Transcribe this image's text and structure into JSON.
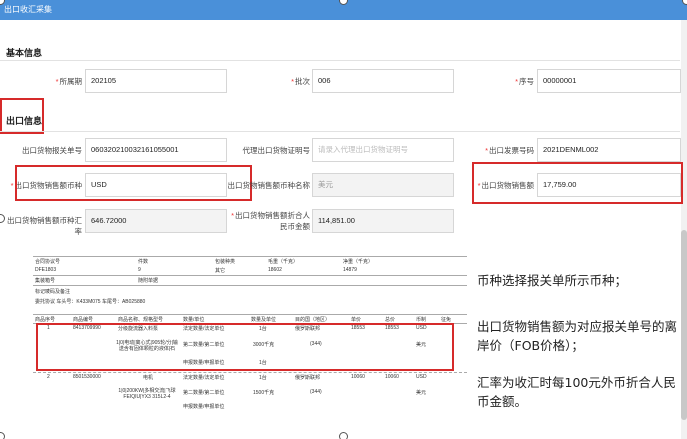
{
  "window": {
    "title": "出口收汇采集"
  },
  "basic": {
    "section_title": "基本信息",
    "period_label": "所属期",
    "period_value": "202105",
    "batch_label": "批次",
    "batch_value": "006",
    "seq_label": "序号",
    "seq_value": "00000001"
  },
  "export": {
    "section_title": "出口信息",
    "customs_label": "出口货物报关单号",
    "customs_value": "060320210032161055001",
    "agent_label": "代理出口货物证明号",
    "agent_placeholder": "请录入代理出口货物证明号",
    "invoice_label": "出口发票号码",
    "invoice_value": "2021DENML002",
    "currency_label": "出口货物销售额币种",
    "currency_value": "USD",
    "currency_name_label": "出口货物销售额币种名称",
    "currency_name_value": "美元",
    "sales_label": "出口货物销售额",
    "sales_value": "17,759.00",
    "rate_label": "出口货物销售额币种汇率",
    "rate_value": "646.72000",
    "rmb_label": "出口货物销售额折合人民币金额",
    "rmb_value": "114,851.00"
  },
  "document": {
    "header_row1": [
      "合同协议号",
      "件数",
      "包装种类",
      "毛重（千克）",
      "净重（千克）"
    ],
    "header_row1_values": [
      "DFE1803",
      "9",
      "其它",
      "18602",
      "14879"
    ],
    "mark_label": "集装箱号",
    "mark_value": "随附单据",
    "remark_label": "标记唛码及备注",
    "remark_value": "委托协议 车头号：K433M075 车尾号：AB025880",
    "cols": [
      "项号",
      "商品编号",
      "商品名称、规格型号",
      "数量及单位",
      "单价/总价/币制",
      "原产国(地区)",
      "最终目的国(地区)",
      "境内货源地",
      "征免"
    ],
    "col_short": [
      "商品序号",
      "商品编号",
      "商品名称、规格型号",
      "数量/单位",
      "数量及单位",
      "目的国（地区）",
      "单价",
      "总价",
      "币制",
      "征免"
    ],
    "item1": {
      "no": "1",
      "code": "8413709990",
      "name": "分级旋流器入料泵",
      "unit1": "法定数量/法定单位",
      "qty1": "1台",
      "dest": "俄罗斯联邦",
      "price": "18553",
      "total": "18553",
      "cur": "USD",
      "spec": "1|0|电动|离心式|905轮/分|输送含有固体颗粒的液体|石",
      "unit2": "第二数量/第二单位",
      "qty2": "3000千克",
      "code2": "(344)",
      "cur_name": "美元",
      "unit3": "申报数量/申报单位",
      "qty3": "1台"
    },
    "item2": {
      "no": "2",
      "code": "8501530000",
      "name": "电机",
      "unit1": "法定数量/法定单位",
      "qty1": "1台",
      "dest": "俄罗斯联邦",
      "price": "10060",
      "total": "10060",
      "cur": "USD",
      "spec": "1|0|200KW|多相交流|飞球 FEIQIU|YX3 315L2-4",
      "unit2": "第二数量/第二单位",
      "qty2": "1500千克",
      "code2": "(344)",
      "cur_name": "美元",
      "unit3": "申报数量/申报单位"
    }
  },
  "notes": [
    "币种选择报关单所示币种；",
    "出口货物销售额为对应报关单号的离岸价（FOB价格）；",
    "汇率为收汇时每100元外币折合人民币金额。"
  ]
}
